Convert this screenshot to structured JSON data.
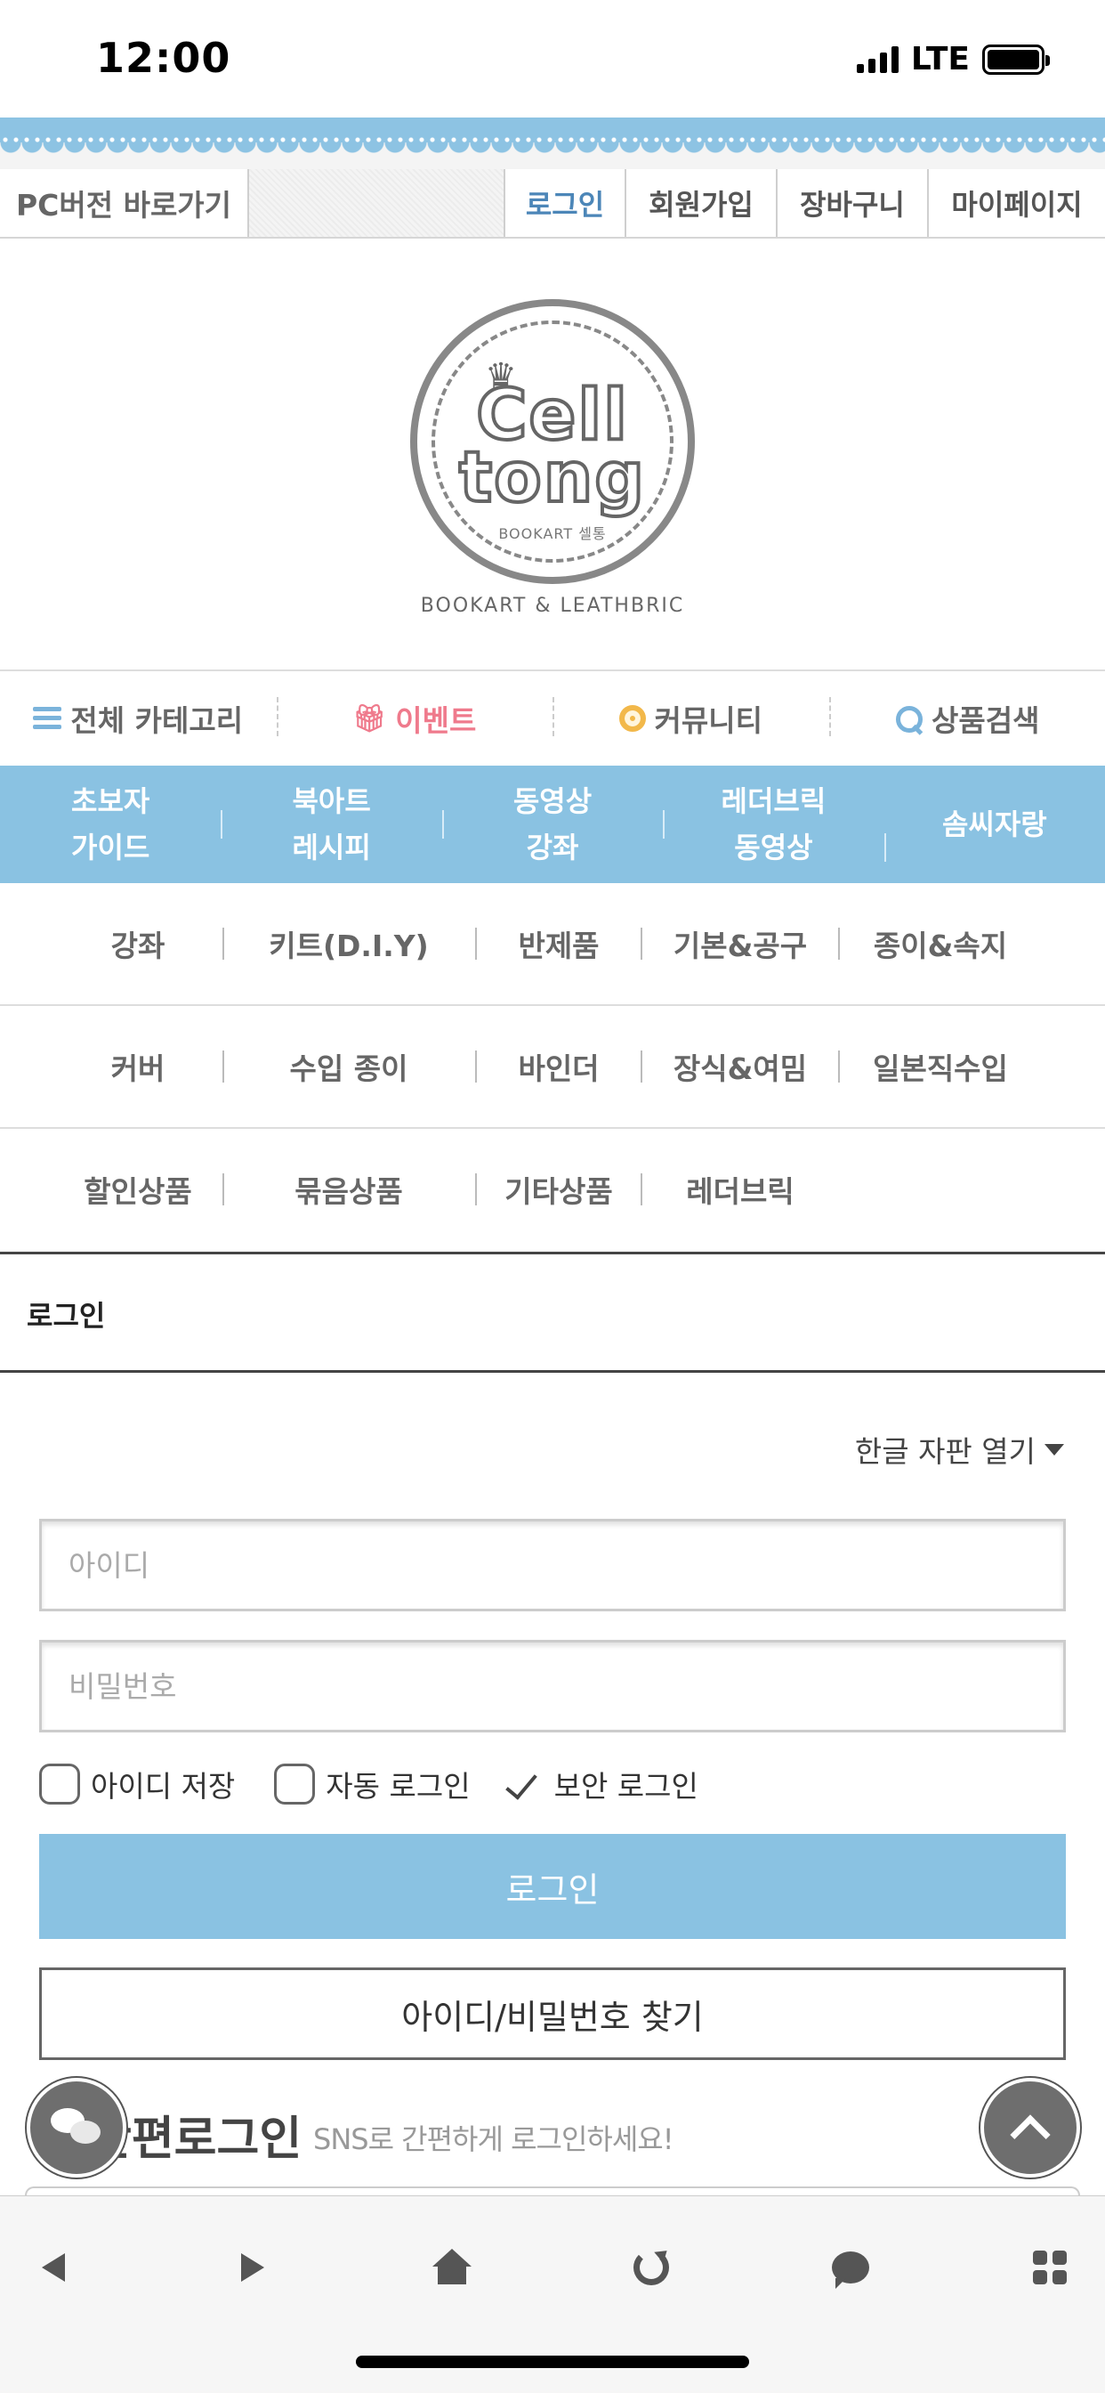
{
  "status_bar": {
    "time": "12:00",
    "network": "LTE"
  },
  "top_bar": {
    "pc_link": "PC버전 바로가기",
    "links": [
      "로그인",
      "회원가입",
      "장바구니",
      "마이페이지"
    ]
  },
  "logo": {
    "caption": "BOOKART & LEATHBRIC"
  },
  "category_nav": {
    "all": "전체 카테고리",
    "event": "이벤트",
    "community": "커뮤니티",
    "search": "상품검색"
  },
  "blue_menu": [
    "초보자\n가이드",
    "북아트\n레시피",
    "동영상\n강좌",
    "레더브릭\n동영상",
    "솜씨자랑"
  ],
  "sub_categories": [
    [
      "강좌",
      "키트(D.I.Y)",
      "반제품",
      "기본&공구",
      "종이&속지"
    ],
    [
      "커버",
      "수입 종이",
      "바인더",
      "장식&여밈",
      "일본직수입"
    ],
    [
      "할인상품",
      "묶음상품",
      "기타상품",
      "레더브릭"
    ]
  ],
  "page_title": "로그인",
  "form": {
    "keyboard_toggle": "한글 자판 열기",
    "id_placeholder": "아이디",
    "password_placeholder": "비밀번호",
    "save_id": "아이디 저장",
    "auto_login": "자동 로그인",
    "secure_login": "보안 로그인",
    "login_button": "로그인",
    "find_button": "아이디/비밀번호 찾기"
  },
  "sns": {
    "title": "간편로그인",
    "subtitle": "SNS로 간편하게 로그인하세요!"
  },
  "colors": {
    "accent": "#8ac2e2",
    "event": "#ef7a8c",
    "login_link": "#4c86b8"
  }
}
